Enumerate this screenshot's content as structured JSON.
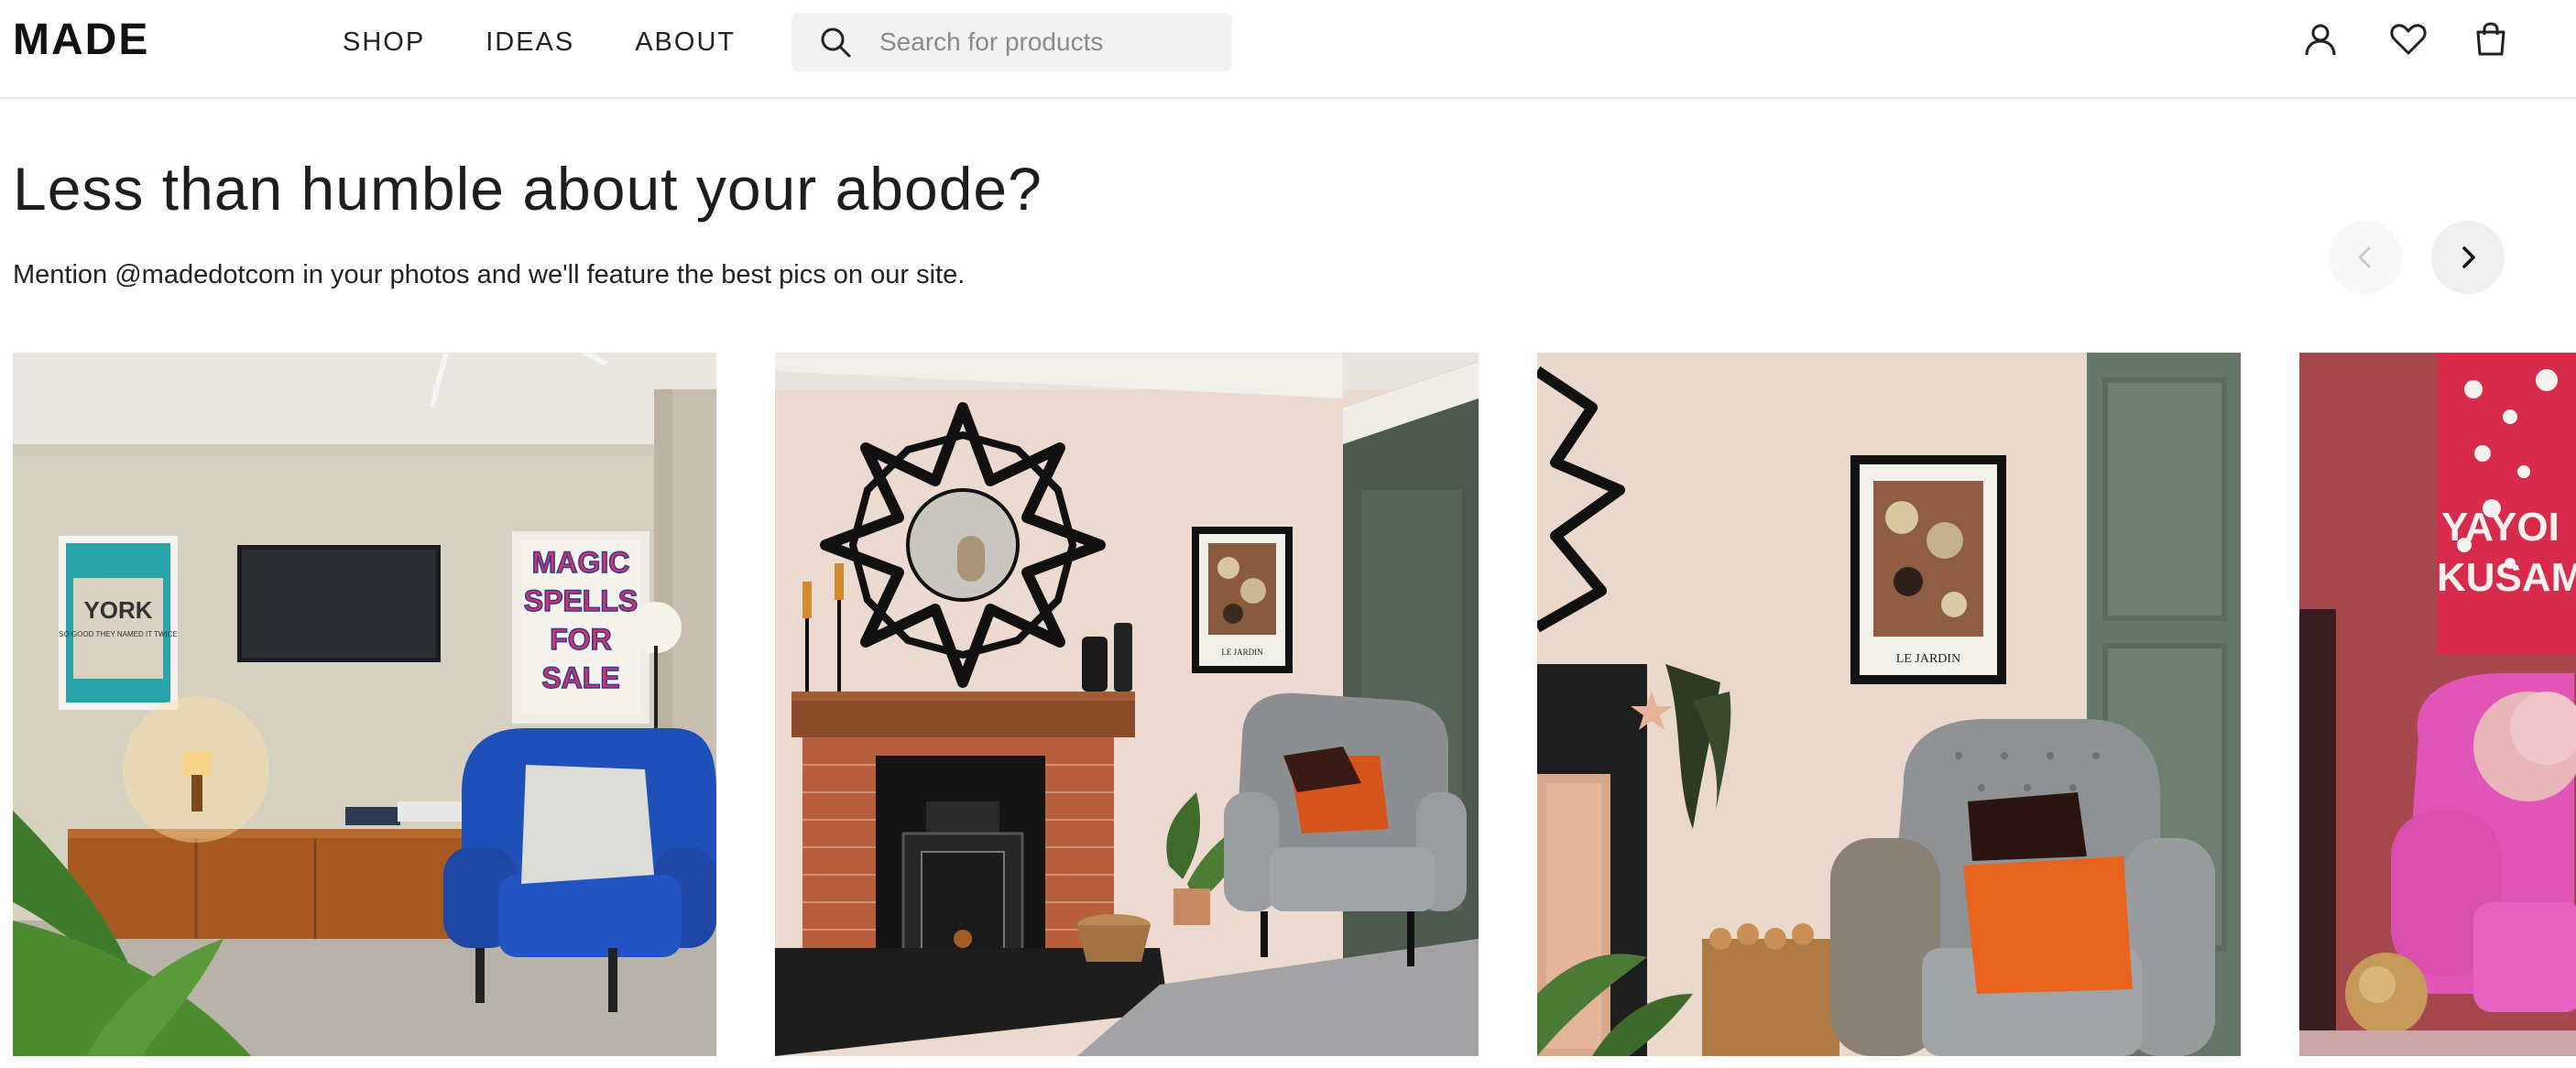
{
  "header": {
    "logo": "MADE",
    "nav": [
      "SHOP",
      "IDEAS",
      "ABOUT"
    ],
    "search_placeholder": "Search for products",
    "icons": [
      "account-icon",
      "wishlist-heart-icon",
      "bag-icon"
    ]
  },
  "section": {
    "title": "Less than humble about your abode?",
    "subtitle": "Mention @madedotcom in your photos and we'll feature the best pics on our site."
  },
  "gallery": {
    "photos": [
      {
        "name": "living-room-blue-armchair",
        "poster_left": {
          "line1": "YORK",
          "line2": "SO GOOD THEY NAMED IT TWICE"
        },
        "poster_right": [
          "MAGIC",
          "SPELLS",
          "FOR",
          "SALE"
        ]
      },
      {
        "name": "fireplace-sunburst-mirror",
        "print_caption": "LE JARDIN"
      },
      {
        "name": "grey-armchair-orange-cushion",
        "print_caption": "LE JARDIN"
      },
      {
        "name": "pink-armchair-kusama",
        "poster_lines": [
          "YAYOI",
          "KUSAMA"
        ]
      }
    ]
  },
  "colors": {
    "text": "#222222",
    "search_bg": "#f2f2f2",
    "divider": "#e6e6e6",
    "arrow_bg": "#efefef"
  }
}
